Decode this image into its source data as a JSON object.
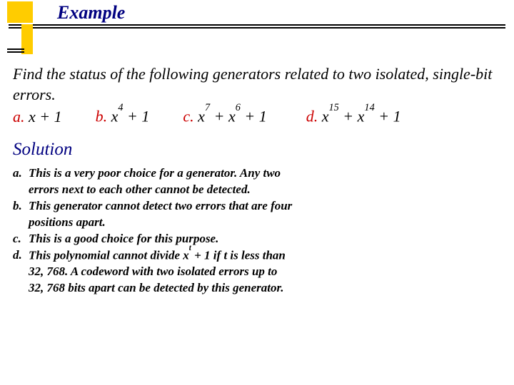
{
  "title": "Example",
  "question": {
    "intro": "Find the status of the following generators related to two isolated, single-bit errors.",
    "options": {
      "a": {
        "label": "a.",
        "expr": "x + 1"
      },
      "b": {
        "label": "b.",
        "base": "x",
        "exp": "4",
        "tail": " + 1"
      },
      "c": {
        "label": "c.",
        "p1b": "x",
        "p1e": "7",
        "mid": " + x",
        "p2e": "6",
        "tail": " + 1"
      },
      "d": {
        "label": "d.",
        "p1b": "x",
        "p1e": "15",
        "mid": " + x",
        "p2e": "14",
        "tail": " + 1"
      }
    }
  },
  "solution_label": "Solution",
  "answers": {
    "a": {
      "label": "a.",
      "line1": "This is a very poor choice for a generator. Any two",
      "line2": "errors next to each other cannot be detected."
    },
    "b": {
      "label": "b.",
      "line1": "This generator cannot detect two errors that are four",
      "line2": "positions apart."
    },
    "c": {
      "label": "c.",
      "line1": "This is a good choice for this purpose."
    },
    "d": {
      "label": "d.",
      "line1_pre": "This polynomial cannot divide x",
      "line1_sup": "t",
      "line1_post": " + 1 if t is less than",
      "line2": "32, 768. A codeword with two isolated errors up to",
      "line3": "32, 768 bits apart can be detected by this generator."
    }
  }
}
